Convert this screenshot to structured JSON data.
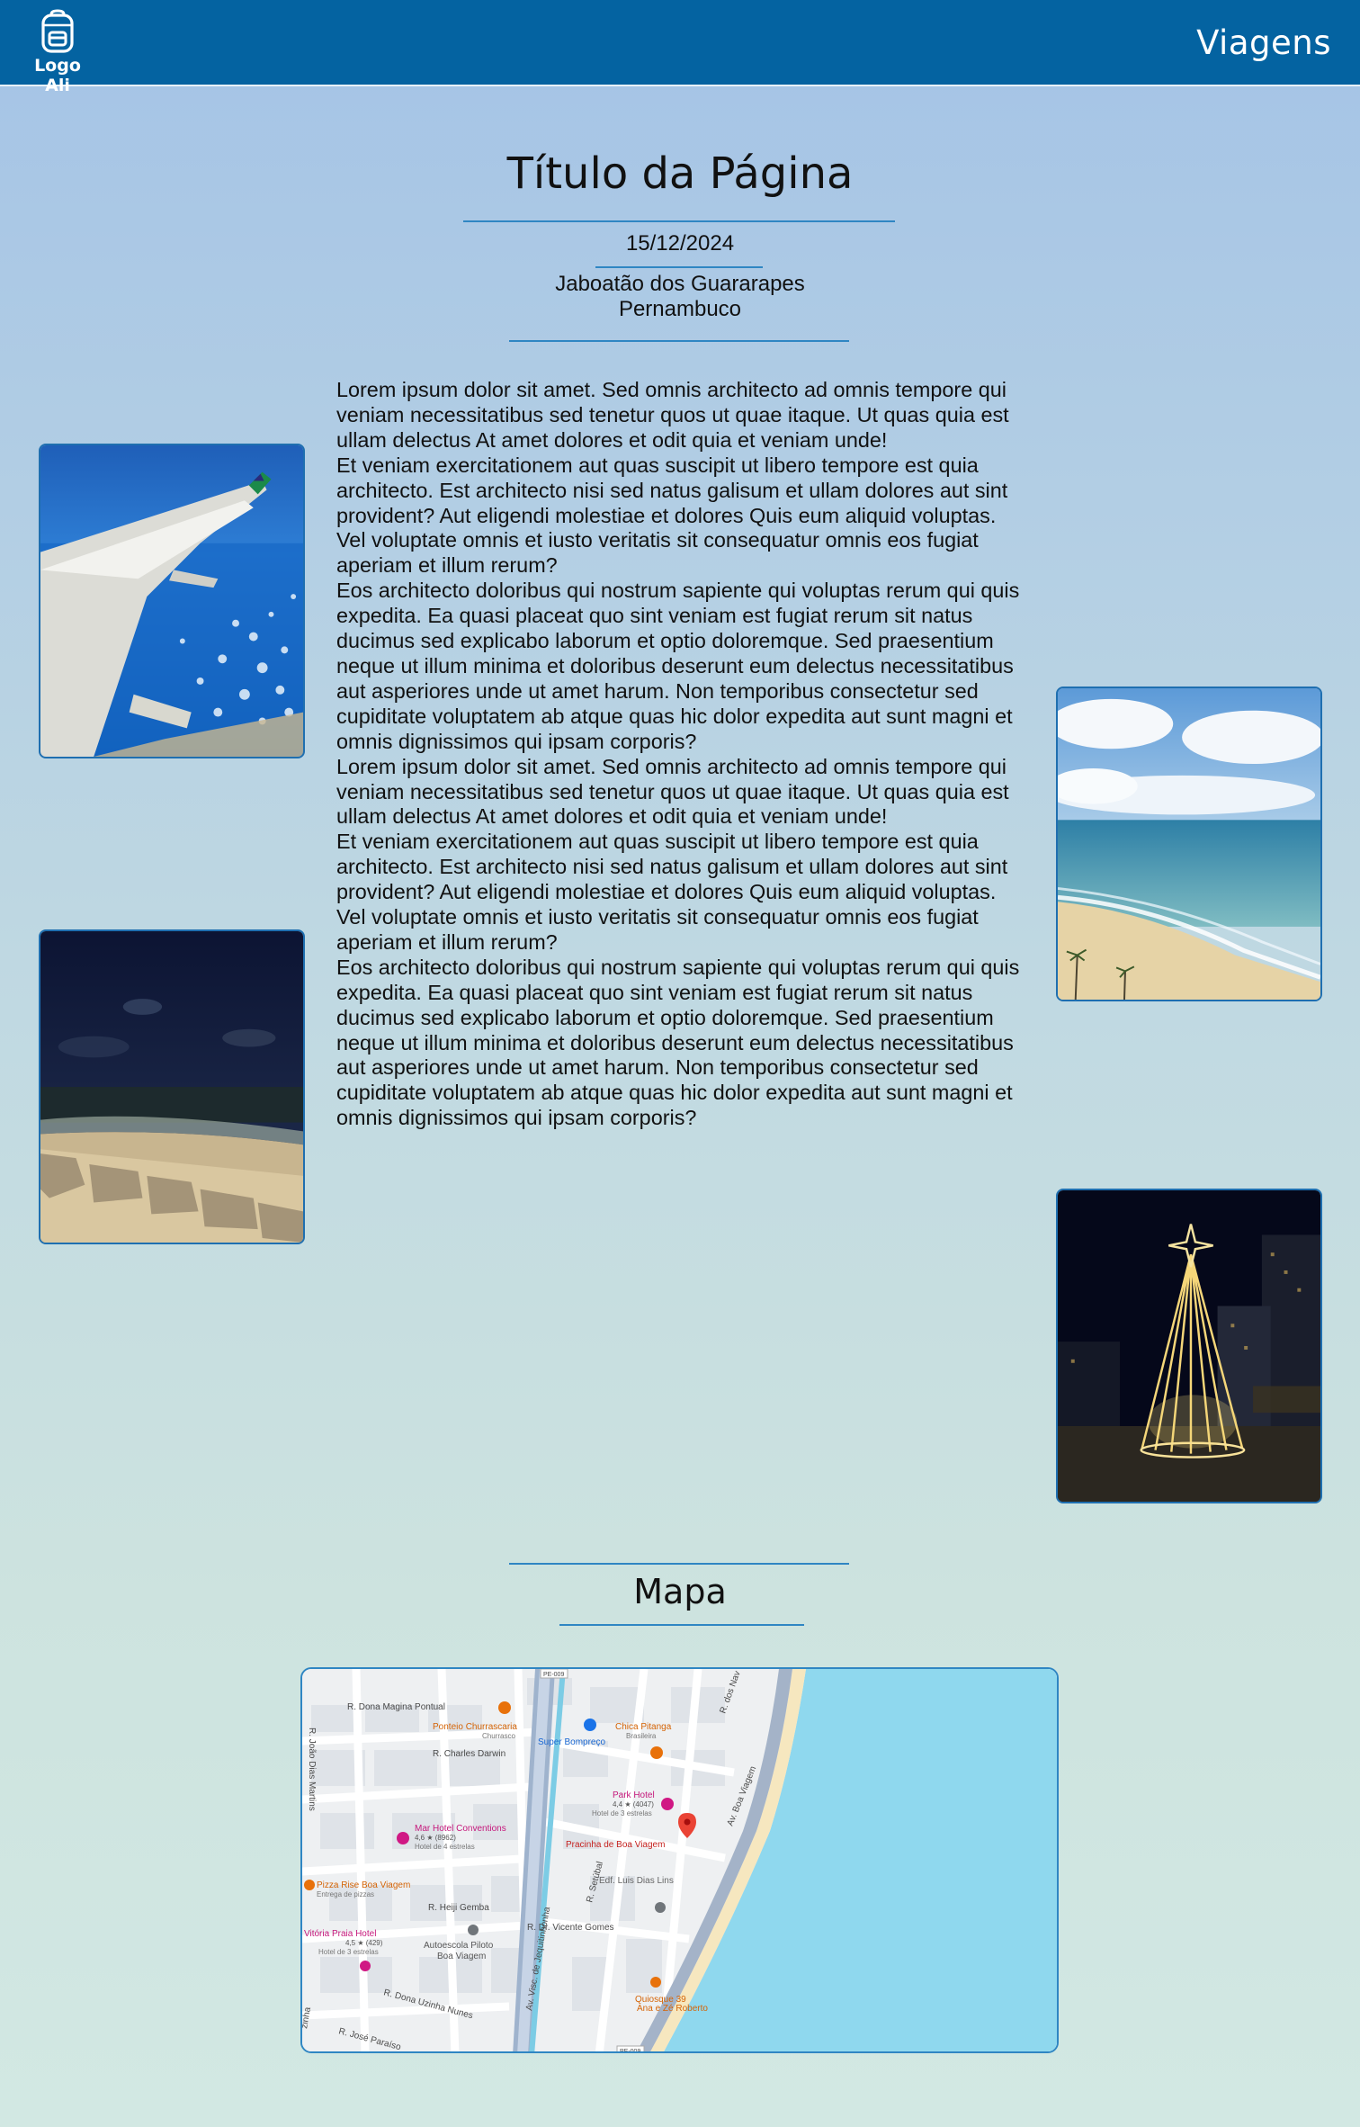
{
  "header": {
    "logo_text": "Logo Ali",
    "nav_title": "Viagens"
  },
  "page": {
    "title": "Título da Página",
    "date": "15/12/2024",
    "city": "Jaboatão dos Guararapes",
    "state": "Pernambuco"
  },
  "article": {
    "paragraphs": [
      "Lorem ipsum dolor sit amet. Sed omnis architecto ad omnis tempore qui veniam necessitatibus sed tenetur quos ut quae itaque. Ut quas quia est ullam delectus At amet dolores et odit quia et veniam unde!",
      "Et veniam exercitationem aut quas suscipit ut libero tempore est quia architecto. Est architecto nisi sed natus galisum et ullam dolores aut sint provident? Aut eligendi molestiae et dolores Quis eum aliquid voluptas. Vel voluptate omnis et iusto veritatis sit consequatur omnis eos fugiat aperiam et illum rerum?",
      "Eos architecto doloribus qui nostrum sapiente qui voluptas rerum qui quis expedita. Ea quasi placeat quo sint veniam est fugiat rerum sit natus ducimus sed explicabo laborum et optio doloremque. Sed praesentium neque ut illum minima et doloribus deserunt eum delectus necessitatibus aut asperiores unde ut amet harum. Non temporibus consectetur sed cupiditate voluptatem ab atque quas hic dolor expedita aut sunt magni et omnis dignissimos qui ipsam corporis?",
      "Lorem ipsum dolor sit amet. Sed omnis architecto ad omnis tempore qui veniam necessitatibus sed tenetur quos ut quae itaque. Ut quas quia est ullam delectus At amet dolores et odit quia et veniam unde!",
      "Et veniam exercitationem aut quas suscipit ut libero tempore est quia architecto. Est architecto nisi sed natus galisum et ullam dolores aut sint provident? Aut eligendi molestiae et dolores Quis eum aliquid voluptas. Vel voluptate omnis et iusto veritatis sit consequatur omnis eos fugiat aperiam et illum rerum?",
      "Eos architecto doloribus qui nostrum sapiente qui voluptas rerum qui quis expedita. Ea quasi placeat quo sint veniam est fugiat rerum sit natus ducimus sed explicabo laborum et optio doloremque. Sed praesentium neque ut illum minima et doloribus deserunt eum delectus necessitatibus aut asperiores unde ut amet harum. Non temporibus consectetur sed cupiditate voluptatem ab atque quas hic dolor expedita aut sunt magni et omnis dignissimos qui ipsam corporis?"
    ]
  },
  "photos": [
    {
      "name": "airplane-wing-photo"
    },
    {
      "name": "night-beach-photo"
    },
    {
      "name": "beach-day-photo"
    },
    {
      "name": "christmas-tree-photo"
    }
  ],
  "map_section": {
    "title": "Mapa",
    "labels": {
      "road_pe009": "PE-009",
      "dona_magina": "R. Dona Magina Pontual",
      "ponteio": "Ponteio Churrascaria",
      "ponteio_sub": "Churrasco",
      "super": "Super Bompreço",
      "chica": "Chica Pitanga",
      "chica_sub": "Brasileira",
      "dos_navegantes": "R. dos Nav",
      "charles": "R. Charles Darwin",
      "joao_dias": "R. João Dias Martins",
      "park": "Park Hotel",
      "park_rating": "4,4 ★ (4047)",
      "park_sub": "Hotel de 3 estrelas",
      "mar": "Mar Hotel Conventions",
      "mar_rating": "4,6 ★ (8962)",
      "mar_sub": "Hotel de 4 estrelas",
      "pracinha": "Pracinha de Boa Viagem",
      "boa_viagem_ave": "Av. Boa Viagem",
      "pizza": "Pizza Rise Boa Viagem",
      "pizza_sub": "Entrega de pizzas",
      "setubal": "R. Setúbal",
      "edf": "Edf. Luis Dias Lins",
      "heiji": "R. Heiji Gemba",
      "vicente": "R. Dr. Vicente Gomes",
      "vitoria": "Vitória Praia Hotel",
      "vitoria_rating": "4,5 ★ (429)",
      "vitoria_sub": "Hotel de 3 estrelas",
      "autoescola": "Autoescola Piloto",
      "autoescola_sub": "Boa Viagem",
      "jequitinhonha": "Av. Visc. de Jequitinhonha",
      "uzinha": "R. Dona Uzinha Nunes",
      "quiosque": "Quiosque 39",
      "quiosque_sub": "Ana e Zé Roberto",
      "jose": "R. José Paraíso",
      "zinha": "zinha"
    }
  },
  "colors": {
    "header_bg": "#0463a1",
    "accent_rule": "#2f86c3",
    "map_sea": "#8fd8ee",
    "poi_orange": "#e8710a",
    "poi_pink": "#d01884",
    "pin_red": "#ea4335"
  }
}
